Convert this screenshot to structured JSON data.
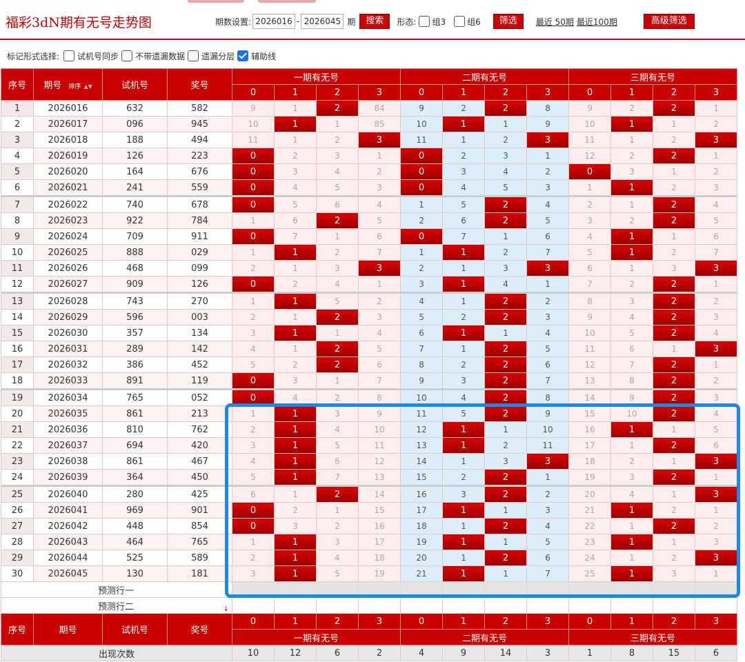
{
  "header": {
    "title": "福彩3dN期有无号走势图",
    "period_label": "期数设置:",
    "period_from": "2026016",
    "period_to": "2026045",
    "period_unit": "期",
    "search_button": "搜索",
    "form_label": "形态:",
    "opt_group3": "组3",
    "opt_group6": "组6",
    "filter_button": "筛选",
    "recent50": "最近 50期",
    "recent100": "最近100期",
    "advanced_button": "高级筛选"
  },
  "markrow": {
    "label": "标记形式选择:",
    "opt1": "试机号同步",
    "opt2": "不带遗漏数据",
    "opt3": "遗漏分层",
    "opt4": "辅助线"
  },
  "table_header": {
    "seq": "序号",
    "period": "期号",
    "sort": "排序",
    "trial": "试机号",
    "prize": "奖号",
    "g1": "一期有无号",
    "g2": "二期有无号",
    "g3": "三期有无号",
    "digits": [
      "0",
      "1",
      "2",
      "3"
    ]
  },
  "rows": [
    {
      "seq": "1",
      "period": "2026016",
      "trial": "632",
      "prize": "582",
      "g1": [
        "9",
        "1",
        "2",
        "84"
      ],
      "g2": [
        "9",
        "2",
        "2",
        "8"
      ],
      "g3": [
        "9",
        "2",
        "2",
        "1"
      ],
      "hits": [
        2,
        6,
        10
      ]
    },
    {
      "seq": "2",
      "period": "2026017",
      "trial": "096",
      "prize": "945",
      "g1": [
        "10",
        "1",
        "1",
        "85"
      ],
      "g2": [
        "10",
        "1",
        "1",
        "9"
      ],
      "g3": [
        "10",
        "1",
        "1",
        "2"
      ],
      "hits": [
        1,
        5,
        9
      ]
    },
    {
      "seq": "3",
      "period": "2026018",
      "trial": "188",
      "prize": "494",
      "g1": [
        "11",
        "1",
        "2",
        "3"
      ],
      "g2": [
        "11",
        "1",
        "2",
        "3"
      ],
      "g3": [
        "11",
        "1",
        "2",
        "3"
      ],
      "hits": [
        3,
        7,
        11
      ]
    },
    {
      "seq": "4",
      "period": "2026019",
      "trial": "126",
      "prize": "223",
      "g1": [
        "0",
        "2",
        "3",
        "1"
      ],
      "g2": [
        "0",
        "2",
        "3",
        "1"
      ],
      "g3": [
        "12",
        "2",
        "2",
        "1"
      ],
      "hits": [
        0,
        4,
        10
      ]
    },
    {
      "seq": "5",
      "period": "2026020",
      "trial": "164",
      "prize": "676",
      "g1": [
        "0",
        "3",
        "4",
        "2"
      ],
      "g2": [
        "0",
        "3",
        "4",
        "2"
      ],
      "g3": [
        "0",
        "3",
        "1",
        "2"
      ],
      "hits": [
        0,
        4,
        8
      ]
    },
    {
      "seq": "6",
      "period": "2026021",
      "trial": "241",
      "prize": "559",
      "g1": [
        "0",
        "4",
        "5",
        "3"
      ],
      "g2": [
        "0",
        "4",
        "5",
        "3"
      ],
      "g3": [
        "1",
        "1",
        "2",
        "3"
      ],
      "hits": [
        0,
        4,
        9
      ]
    },
    {
      "seq": "7",
      "period": "2026022",
      "trial": "740",
      "prize": "678",
      "g1": [
        "0",
        "5",
        "6",
        "4"
      ],
      "g2": [
        "1",
        "5",
        "2",
        "4"
      ],
      "g3": [
        "2",
        "1",
        "2",
        "4"
      ],
      "hits": [
        0,
        6,
        10
      ]
    },
    {
      "seq": "8",
      "period": "2026023",
      "trial": "922",
      "prize": "784",
      "g1": [
        "1",
        "6",
        "2",
        "5"
      ],
      "g2": [
        "2",
        "6",
        "2",
        "5"
      ],
      "g3": [
        "3",
        "2",
        "2",
        "5"
      ],
      "hits": [
        2,
        6,
        10
      ]
    },
    {
      "seq": "9",
      "period": "2026024",
      "trial": "709",
      "prize": "911",
      "g1": [
        "0",
        "7",
        "1",
        "6"
      ],
      "g2": [
        "0",
        "7",
        "1",
        "6"
      ],
      "g3": [
        "4",
        "1",
        "1",
        "6"
      ],
      "hits": [
        0,
        4,
        9
      ]
    },
    {
      "seq": "10",
      "period": "2026025",
      "trial": "888",
      "prize": "029",
      "g1": [
        "1",
        "1",
        "2",
        "7"
      ],
      "g2": [
        "1",
        "1",
        "2",
        "7"
      ],
      "g3": [
        "5",
        "1",
        "2",
        "7"
      ],
      "hits": [
        1,
        5,
        9
      ]
    },
    {
      "seq": "11",
      "period": "2026026",
      "trial": "468",
      "prize": "099",
      "g1": [
        "2",
        "1",
        "3",
        "3"
      ],
      "g2": [
        "2",
        "1",
        "3",
        "3"
      ],
      "g3": [
        "6",
        "1",
        "3",
        "3"
      ],
      "hits": [
        3,
        7,
        11
      ]
    },
    {
      "seq": "12",
      "period": "2026027",
      "trial": "909",
      "prize": "126",
      "g1": [
        "0",
        "2",
        "4",
        "1"
      ],
      "g2": [
        "3",
        "1",
        "4",
        "1"
      ],
      "g3": [
        "7",
        "2",
        "2",
        "1"
      ],
      "hits": [
        0,
        5,
        10
      ]
    },
    {
      "seq": "13",
      "period": "2026028",
      "trial": "743",
      "prize": "270",
      "g1": [
        "1",
        "1",
        "5",
        "2"
      ],
      "g2": [
        "4",
        "1",
        "2",
        "2"
      ],
      "g3": [
        "8",
        "3",
        "2",
        "2"
      ],
      "hits": [
        1,
        6,
        10
      ]
    },
    {
      "seq": "14",
      "period": "2026029",
      "trial": "596",
      "prize": "003",
      "g1": [
        "2",
        "1",
        "2",
        "3"
      ],
      "g2": [
        "5",
        "2",
        "2",
        "3"
      ],
      "g3": [
        "9",
        "4",
        "2",
        "3"
      ],
      "hits": [
        2,
        6,
        10
      ]
    },
    {
      "seq": "15",
      "period": "2026030",
      "trial": "357",
      "prize": "134",
      "g1": [
        "3",
        "1",
        "1",
        "4"
      ],
      "g2": [
        "6",
        "1",
        "1",
        "4"
      ],
      "g3": [
        "10",
        "5",
        "2",
        "4"
      ],
      "hits": [
        1,
        5,
        10
      ]
    },
    {
      "seq": "16",
      "period": "2026031",
      "trial": "289",
      "prize": "142",
      "g1": [
        "4",
        "1",
        "2",
        "5"
      ],
      "g2": [
        "7",
        "1",
        "2",
        "5"
      ],
      "g3": [
        "11",
        "6",
        "1",
        "3"
      ],
      "hits": [
        2,
        6,
        11
      ]
    },
    {
      "seq": "17",
      "period": "2026032",
      "trial": "386",
      "prize": "452",
      "g1": [
        "5",
        "2",
        "2",
        "6"
      ],
      "g2": [
        "8",
        "2",
        "2",
        "6"
      ],
      "g3": [
        "12",
        "7",
        "2",
        "1"
      ],
      "hits": [
        2,
        6,
        10
      ]
    },
    {
      "seq": "18",
      "period": "2026033",
      "trial": "891",
      "prize": "119",
      "g1": [
        "0",
        "3",
        "1",
        "7"
      ],
      "g2": [
        "9",
        "3",
        "2",
        "7"
      ],
      "g3": [
        "13",
        "8",
        "2",
        "2"
      ],
      "hits": [
        0,
        6,
        10
      ]
    },
    {
      "seq": "19",
      "period": "2026034",
      "trial": "765",
      "prize": "052",
      "g1": [
        "0",
        "4",
        "2",
        "8"
      ],
      "g2": [
        "10",
        "4",
        "2",
        "8"
      ],
      "g3": [
        "14",
        "9",
        "2",
        "3"
      ],
      "hits": [
        0,
        6,
        10
      ]
    },
    {
      "seq": "20",
      "period": "2026035",
      "trial": "861",
      "prize": "213",
      "g1": [
        "1",
        "1",
        "3",
        "9"
      ],
      "g2": [
        "11",
        "5",
        "2",
        "9"
      ],
      "g3": [
        "15",
        "10",
        "2",
        "4"
      ],
      "hits": [
        1,
        6,
        10
      ]
    },
    {
      "seq": "21",
      "period": "2026036",
      "trial": "810",
      "prize": "762",
      "g1": [
        "2",
        "1",
        "4",
        "10"
      ],
      "g2": [
        "12",
        "1",
        "1",
        "10"
      ],
      "g3": [
        "16",
        "1",
        "1",
        "5"
      ],
      "hits": [
        1,
        5,
        9
      ]
    },
    {
      "seq": "22",
      "period": "2026037",
      "trial": "694",
      "prize": "420",
      "g1": [
        "3",
        "1",
        "5",
        "11"
      ],
      "g2": [
        "13",
        "1",
        "2",
        "11"
      ],
      "g3": [
        "17",
        "1",
        "2",
        "6"
      ],
      "hits": [
        1,
        5,
        10
      ]
    },
    {
      "seq": "23",
      "period": "2026038",
      "trial": "861",
      "prize": "467",
      "g1": [
        "4",
        "1",
        "6",
        "12"
      ],
      "g2": [
        "14",
        "1",
        "3",
        "3"
      ],
      "g3": [
        "18",
        "2",
        "1",
        "3"
      ],
      "hits": [
        1,
        7,
        11
      ]
    },
    {
      "seq": "24",
      "period": "2026039",
      "trial": "364",
      "prize": "450",
      "g1": [
        "5",
        "1",
        "7",
        "13"
      ],
      "g2": [
        "15",
        "2",
        "2",
        "1"
      ],
      "g3": [
        "19",
        "3",
        "2",
        "1"
      ],
      "hits": [
        1,
        6,
        10
      ]
    },
    {
      "seq": "25",
      "period": "2026040",
      "trial": "280",
      "prize": "425",
      "g1": [
        "6",
        "1",
        "2",
        "14"
      ],
      "g2": [
        "16",
        "3",
        "2",
        "2"
      ],
      "g3": [
        "20",
        "4",
        "1",
        "3"
      ],
      "hits": [
        2,
        6,
        11
      ]
    },
    {
      "seq": "26",
      "period": "2026041",
      "trial": "969",
      "prize": "901",
      "g1": [
        "0",
        "2",
        "1",
        "15"
      ],
      "g2": [
        "17",
        "1",
        "1",
        "3"
      ],
      "g3": [
        "21",
        "1",
        "2",
        "1"
      ],
      "hits": [
        0,
        5,
        9
      ]
    },
    {
      "seq": "27",
      "period": "2026042",
      "trial": "448",
      "prize": "854",
      "g1": [
        "0",
        "3",
        "2",
        "16"
      ],
      "g2": [
        "18",
        "1",
        "2",
        "4"
      ],
      "g3": [
        "22",
        "1",
        "2",
        "2"
      ],
      "hits": [
        0,
        6,
        10
      ]
    },
    {
      "seq": "28",
      "period": "2026043",
      "trial": "464",
      "prize": "765",
      "g1": [
        "1",
        "1",
        "3",
        "17"
      ],
      "g2": [
        "19",
        "1",
        "1",
        "5"
      ],
      "g3": [
        "23",
        "1",
        "1",
        "3"
      ],
      "hits": [
        1,
        5,
        9
      ]
    },
    {
      "seq": "29",
      "period": "2026044",
      "trial": "525",
      "prize": "589",
      "g1": [
        "2",
        "1",
        "4",
        "18"
      ],
      "g2": [
        "20",
        "1",
        "2",
        "6"
      ],
      "g3": [
        "24",
        "1",
        "2",
        "3"
      ],
      "hits": [
        1,
        6,
        11
      ]
    },
    {
      "seq": "30",
      "period": "2026045",
      "trial": "130",
      "prize": "181",
      "g1": [
        "3",
        "1",
        "5",
        "19"
      ],
      "g2": [
        "21",
        "1",
        "1",
        "7"
      ],
      "g3": [
        "25",
        "1",
        "3",
        "1"
      ],
      "hits": [
        1,
        5,
        9
      ]
    }
  ],
  "predict": {
    "row1": "预测行一",
    "row2": "预测行二"
  },
  "stats": {
    "label": "出现次数",
    "values": [
      "10",
      "12",
      "6",
      "2",
      "4",
      "9",
      "14",
      "3",
      "1",
      "8",
      "15",
      "6"
    ]
  },
  "colors": {
    "accent": "#c80000",
    "highlight": "#1e88e5",
    "blue_zone": "#dceefa"
  }
}
